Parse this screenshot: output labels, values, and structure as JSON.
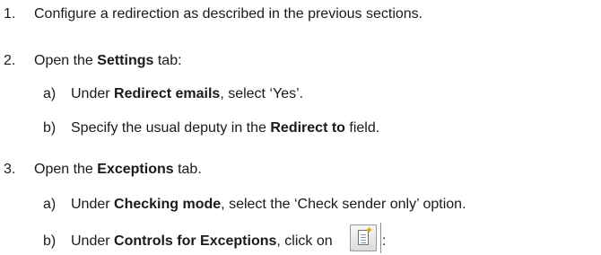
{
  "steps": {
    "s1": {
      "num": "1.",
      "text": "Configure a redirection as described in the previous sections."
    },
    "s2": {
      "num": "2.",
      "pre": "Open the ",
      "bold": "Settings",
      "post": " tab:"
    },
    "s2a": {
      "num": "a)",
      "pre": "Under ",
      "bold": "Redirect emails",
      "post": ", select ‘Yes’."
    },
    "s2b": {
      "num": "b)",
      "pre": "Specify the usual deputy in the ",
      "bold": "Redirect to",
      "post": " field."
    },
    "s3": {
      "num": "3.",
      "pre": "Open the ",
      "bold": "Exceptions",
      "post": " tab."
    },
    "s3a": {
      "num": "a)",
      "pre": "Under ",
      "bold": "Checking mode",
      "post": ", select the ‘Check sender only’ option."
    },
    "s3b": {
      "num": "b)",
      "pre": "Under ",
      "bold": "Controls for Exceptions",
      "post": ", click on",
      "icon": "new-entry-icon",
      "trailing": ":"
    }
  }
}
